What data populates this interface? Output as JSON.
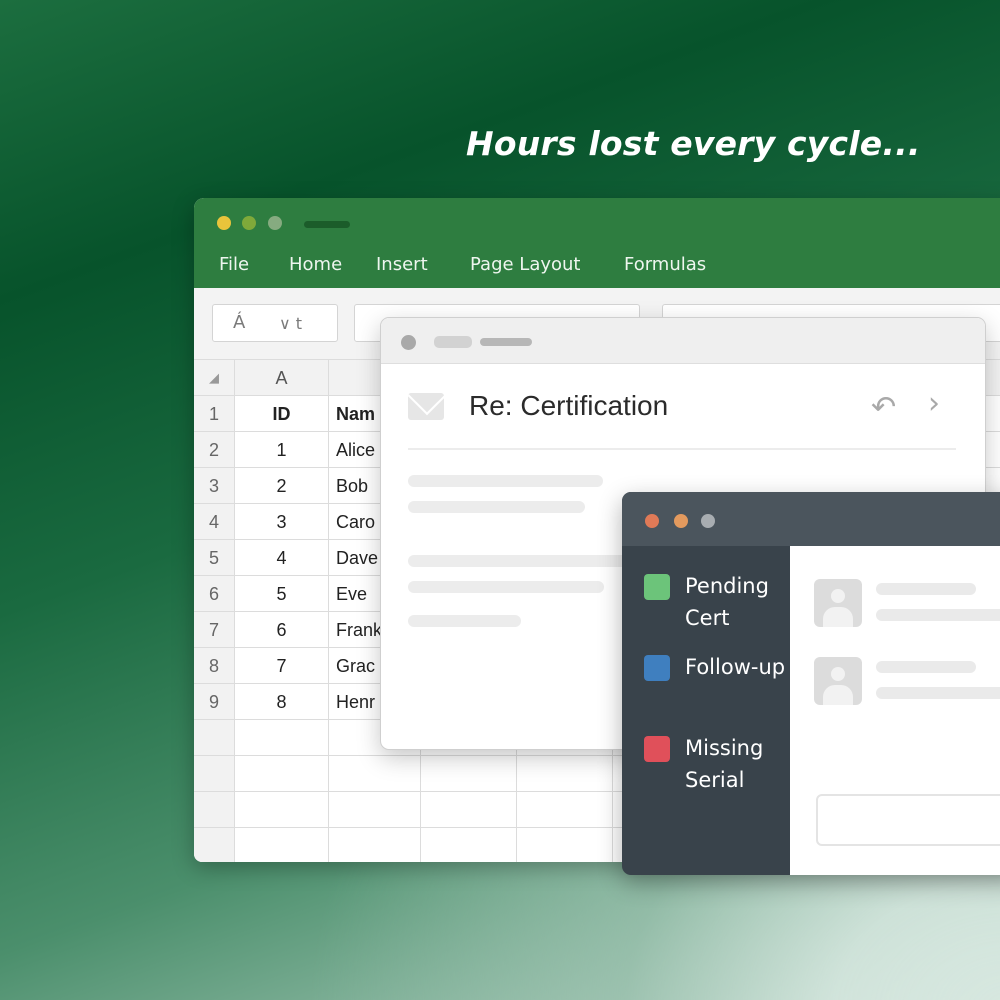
{
  "headline": "Hours lost every cycle...",
  "spreadsheet": {
    "menu": [
      "File",
      "Home",
      "Insert",
      "Page Layout",
      "Formulas"
    ],
    "font_box": "Á",
    "font_menu": "∨ t",
    "column_header": "A",
    "rows": [
      {
        "num": "1",
        "id": "ID",
        "name": "Nam"
      },
      {
        "num": "2",
        "id": "1",
        "name": "Alice"
      },
      {
        "num": "3",
        "id": "2",
        "name": "Bob"
      },
      {
        "num": "4",
        "id": "3",
        "name": "Caro"
      },
      {
        "num": "5",
        "id": "4",
        "name": "Dave"
      },
      {
        "num": "6",
        "id": "5",
        "name": "Eve"
      },
      {
        "num": "7",
        "id": "6",
        "name": "Frank"
      },
      {
        "num": "8",
        "id": "7",
        "name": "Grac"
      },
      {
        "num": "9",
        "id": "8",
        "name": "Henr"
      }
    ]
  },
  "mail": {
    "subject": "Re: Certification",
    "icons": [
      "envelope-icon",
      "reply-icon",
      "forward-icon"
    ]
  },
  "tags": [
    {
      "label": "Pending Cert",
      "color": "#6cc47a"
    },
    {
      "label": "Follow-up",
      "color": "#3f7fbf"
    },
    {
      "label": "Missing Serial",
      "color": "#e0505a"
    }
  ],
  "colors": {
    "excel_green": "#2e7d40",
    "panel_dark": "#39434b"
  }
}
